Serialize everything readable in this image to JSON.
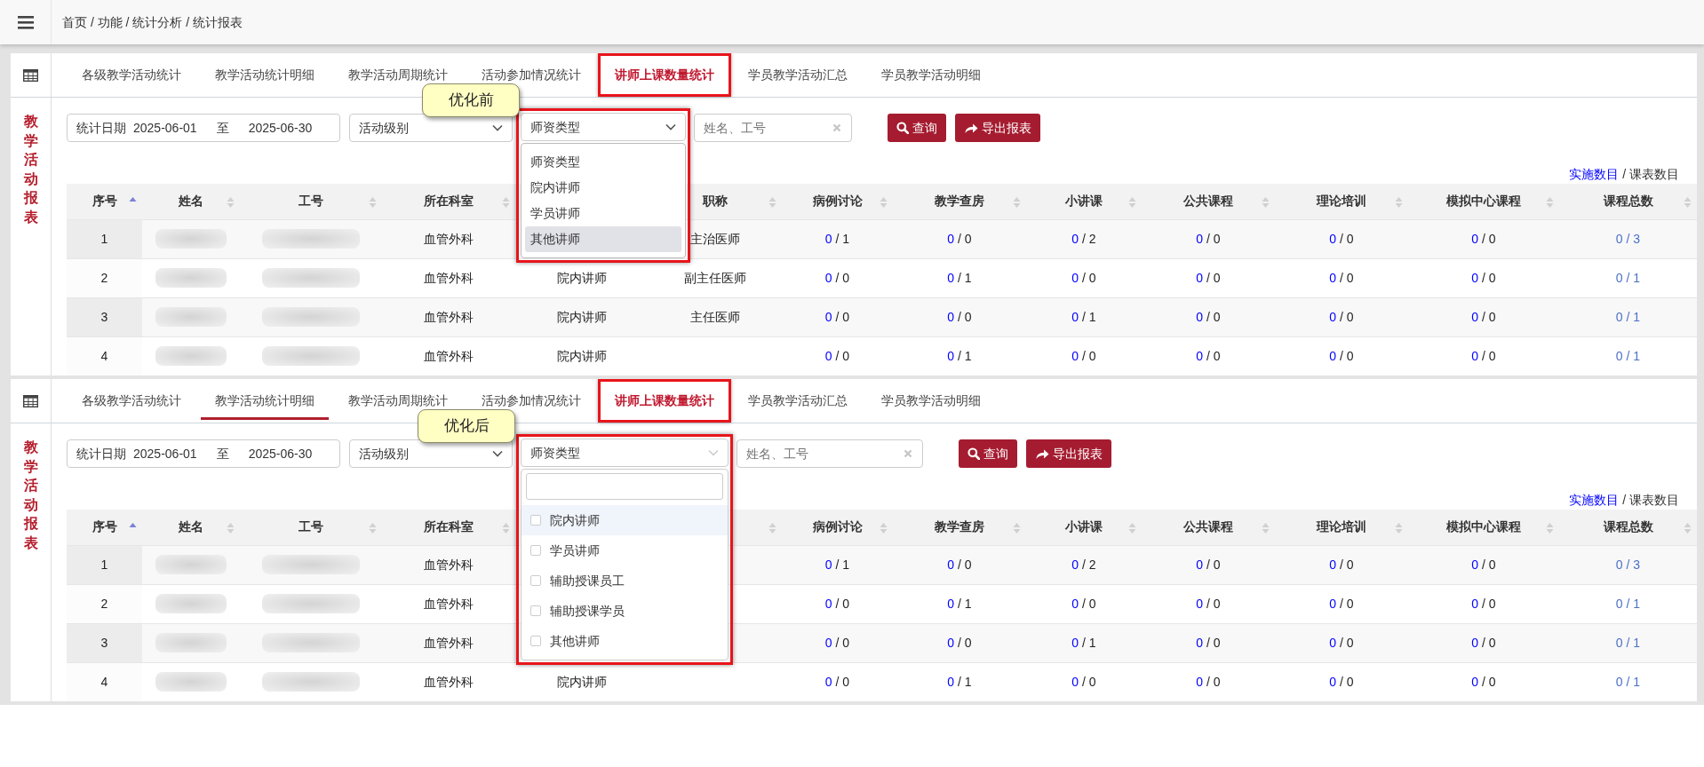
{
  "header": {
    "breadcrumb": "首页 / 功能 / 统计分析 / 统计报表"
  },
  "panels": [
    {
      "callout": "优化前",
      "sidebar_title": "教学活动报表",
      "tabs": [
        {
          "label": "各级教学活动统计",
          "selected": false,
          "underlined": false,
          "framed": false
        },
        {
          "label": "教学活动统计明细",
          "selected": false,
          "underlined": false,
          "framed": false
        },
        {
          "label": "教学活动周期统计",
          "selected": false,
          "underlined": false,
          "framed": false
        },
        {
          "label": "活动参加情况统计",
          "selected": false,
          "underlined": false,
          "framed": false
        },
        {
          "label": "讲师上课数量统计",
          "selected": true,
          "underlined": false,
          "framed": true
        },
        {
          "label": "学员教学活动汇总",
          "selected": false,
          "underlined": false,
          "framed": false
        },
        {
          "label": "学员教学活动明细",
          "selected": false,
          "underlined": false,
          "framed": false
        }
      ],
      "filters": {
        "date_label": "统计日期",
        "start_date": "2025-06-01",
        "range_sep": "至",
        "end_date": "2025-06-30",
        "level_select": "活动级别",
        "type_select": {
          "value": "师资类型",
          "framed": true,
          "dropdown": {
            "kind": "native",
            "options": [
              {
                "label": "师资类型",
                "highlighted": false
              },
              {
                "label": "院内讲师",
                "highlighted": false
              },
              {
                "label": "学员讲师",
                "highlighted": false
              },
              {
                "label": "其他讲师",
                "highlighted": true
              }
            ]
          }
        },
        "name_search": {
          "placeholder": "姓名、工号"
        }
      },
      "buttons": [
        {
          "kind": "query",
          "label": "查询"
        },
        {
          "kind": "export",
          "label": "导出报表"
        }
      ],
      "legend": [
        "实施数目",
        "/",
        "课表数目"
      ],
      "table": {
        "columns": [
          {
            "label": "序号",
            "sort_ascending": true,
            "kind": "text"
          },
          {
            "label": "姓名",
            "sort_ascending": false,
            "kind": "text"
          },
          {
            "label": "工号",
            "sort_ascending": false,
            "kind": "text"
          },
          {
            "label": "所在科室",
            "sort_ascending": false,
            "kind": "text"
          },
          {
            "kind": "text"
          },
          {
            "label": "职称",
            "sort_ascending": false,
            "kind": "text"
          },
          {
            "label": "病例讨论",
            "sort_ascending": false,
            "kind": "count"
          },
          {
            "label": "教学查房",
            "sort_ascending": false,
            "kind": "count"
          },
          {
            "label": "小讲课",
            "sort_ascending": false,
            "kind": "count"
          },
          {
            "label": "公共课程",
            "sort_ascending": false,
            "kind": "count"
          },
          {
            "label": "理论培训",
            "sort_ascending": false,
            "kind": "count"
          },
          {
            "label": "模拟中心课程",
            "sort_ascending": false,
            "kind": "count"
          },
          {
            "label": "课程总数",
            "sort_ascending": false,
            "kind": "total"
          }
        ],
        "rows": [
          [
            "1",
            {
              "redacted": true
            },
            {
              "redacted": true
            },
            "血管外科",
            null,
            "主治医师",
            [
              "0",
              "/",
              "1"
            ],
            [
              "0",
              "/",
              "0"
            ],
            [
              "0",
              "/",
              "2"
            ],
            [
              "0",
              "/",
              "0"
            ],
            [
              "0",
              "/",
              "0"
            ],
            [
              "0",
              "/",
              "0"
            ],
            [
              "0",
              "/",
              "3"
            ]
          ],
          [
            "2",
            {
              "redacted": true
            },
            {
              "redacted": true
            },
            "血管外科",
            "院内讲师",
            "副主任医师",
            [
              "0",
              "/",
              "0"
            ],
            [
              "0",
              "/",
              "1"
            ],
            [
              "0",
              "/",
              "0"
            ],
            [
              "0",
              "/",
              "0"
            ],
            [
              "0",
              "/",
              "0"
            ],
            [
              "0",
              "/",
              "0"
            ],
            [
              "0",
              "/",
              "1"
            ]
          ],
          [
            "3",
            {
              "redacted": true
            },
            {
              "redacted": true
            },
            "血管外科",
            "院内讲师",
            "主任医师",
            [
              "0",
              "/",
              "0"
            ],
            [
              "0",
              "/",
              "0"
            ],
            [
              "0",
              "/",
              "1"
            ],
            [
              "0",
              "/",
              "0"
            ],
            [
              "0",
              "/",
              "0"
            ],
            [
              "0",
              "/",
              "0"
            ],
            [
              "0",
              "/",
              "1"
            ]
          ],
          [
            "4",
            {
              "redacted": true
            },
            {
              "redacted": true
            },
            "血管外科",
            "院内讲师",
            null,
            [
              "0",
              "/",
              "0"
            ],
            [
              "0",
              "/",
              "1"
            ],
            [
              "0",
              "/",
              "0"
            ],
            [
              "0",
              "/",
              "0"
            ],
            [
              "0",
              "/",
              "0"
            ],
            [
              "0",
              "/",
              "0"
            ],
            [
              "0",
              "/",
              "1"
            ]
          ]
        ]
      }
    },
    {
      "callout": "优化后",
      "sidebar_title": "教学活动报表",
      "tabs": [
        {
          "label": "各级教学活动统计",
          "selected": false,
          "underlined": false,
          "framed": false
        },
        {
          "label": "教学活动统计明细",
          "selected": false,
          "underlined": true,
          "framed": false
        },
        {
          "label": "教学活动周期统计",
          "selected": false,
          "underlined": false,
          "framed": false
        },
        {
          "label": "活动参加情况统计",
          "selected": false,
          "underlined": false,
          "framed": false
        },
        {
          "label": "讲师上课数量统计",
          "selected": true,
          "underlined": false,
          "framed": true
        },
        {
          "label": "学员教学活动汇总",
          "selected": false,
          "underlined": false,
          "framed": false
        },
        {
          "label": "学员教学活动明细",
          "selected": false,
          "underlined": false,
          "framed": false
        }
      ],
      "filters": {
        "date_label": "统计日期",
        "start_date": "2025-06-01",
        "range_sep": "至",
        "end_date": "2025-06-30",
        "level_select": "活动级别",
        "type_select": {
          "value": "师资类型",
          "framed": true,
          "dropdown": {
            "kind": "multi",
            "options": [
              {
                "label": "院内讲师",
                "highlighted": true,
                "checked": false
              },
              {
                "label": "学员讲师",
                "highlighted": false,
                "checked": false
              },
              {
                "label": "辅助授课员工",
                "highlighted": false,
                "checked": false
              },
              {
                "label": "辅助授课学员",
                "highlighted": false,
                "checked": false
              },
              {
                "label": "其他讲师",
                "highlighted": false,
                "checked": false
              }
            ]
          }
        },
        "name_search": {
          "placeholder": "姓名、工号"
        }
      },
      "buttons": [
        {
          "kind": "query",
          "label": "查询"
        },
        {
          "kind": "export",
          "label": "导出报表"
        }
      ],
      "legend": [
        "实施数目",
        "/",
        "课表数目"
      ],
      "table": {
        "columns": [
          {
            "label": "序号",
            "sort_ascending": true,
            "kind": "text"
          },
          {
            "label": "姓名",
            "sort_ascending": false,
            "kind": "text"
          },
          {
            "label": "工号",
            "sort_ascending": false,
            "kind": "text"
          },
          {
            "label": "所在科室",
            "sort_ascending": false,
            "kind": "text"
          },
          {
            "kind": "text"
          },
          {
            "sort_ascending": false,
            "kind": "text"
          },
          {
            "label": "病例讨论",
            "sort_ascending": false,
            "kind": "count"
          },
          {
            "label": "教学查房",
            "sort_ascending": false,
            "kind": "count"
          },
          {
            "label": "小讲课",
            "sort_ascending": false,
            "kind": "count"
          },
          {
            "label": "公共课程",
            "sort_ascending": false,
            "kind": "count"
          },
          {
            "label": "理论培训",
            "sort_ascending": false,
            "kind": "count"
          },
          {
            "label": "模拟中心课程",
            "sort_ascending": false,
            "kind": "count"
          },
          {
            "label": "课程总数",
            "sort_ascending": false,
            "kind": "total"
          }
        ],
        "rows": [
          [
            "1",
            {
              "redacted": true
            },
            {
              "redacted": true
            },
            "血管外科",
            null,
            null,
            [
              "0",
              "/",
              "1"
            ],
            [
              "0",
              "/",
              "0"
            ],
            [
              "0",
              "/",
              "2"
            ],
            [
              "0",
              "/",
              "0"
            ],
            [
              "0",
              "/",
              "0"
            ],
            [
              "0",
              "/",
              "0"
            ],
            [
              "0",
              "/",
              "3"
            ]
          ],
          [
            "2",
            {
              "redacted": true
            },
            {
              "redacted": true
            },
            "血管外科",
            null,
            null,
            [
              "0",
              "/",
              "0"
            ],
            [
              "0",
              "/",
              "1"
            ],
            [
              "0",
              "/",
              "0"
            ],
            [
              "0",
              "/",
              "0"
            ],
            [
              "0",
              "/",
              "0"
            ],
            [
              "0",
              "/",
              "0"
            ],
            [
              "0",
              "/",
              "1"
            ]
          ],
          [
            "3",
            {
              "redacted": true
            },
            {
              "redacted": true
            },
            "血管外科",
            null,
            null,
            [
              "0",
              "/",
              "0"
            ],
            [
              "0",
              "/",
              "0"
            ],
            [
              "0",
              "/",
              "1"
            ],
            [
              "0",
              "/",
              "0"
            ],
            [
              "0",
              "/",
              "0"
            ],
            [
              "0",
              "/",
              "0"
            ],
            [
              "0",
              "/",
              "1"
            ]
          ],
          [
            "4",
            {
              "redacted": true
            },
            {
              "redacted": true
            },
            "血管外科",
            "院内讲师",
            null,
            [
              "0",
              "/",
              "0"
            ],
            [
              "0",
              "/",
              "1"
            ],
            [
              "0",
              "/",
              "0"
            ],
            [
              "0",
              "/",
              "0"
            ],
            [
              "0",
              "/",
              "0"
            ],
            [
              "0",
              "/",
              "0"
            ],
            [
              "0",
              "/",
              "1"
            ]
          ]
        ]
      }
    }
  ]
}
